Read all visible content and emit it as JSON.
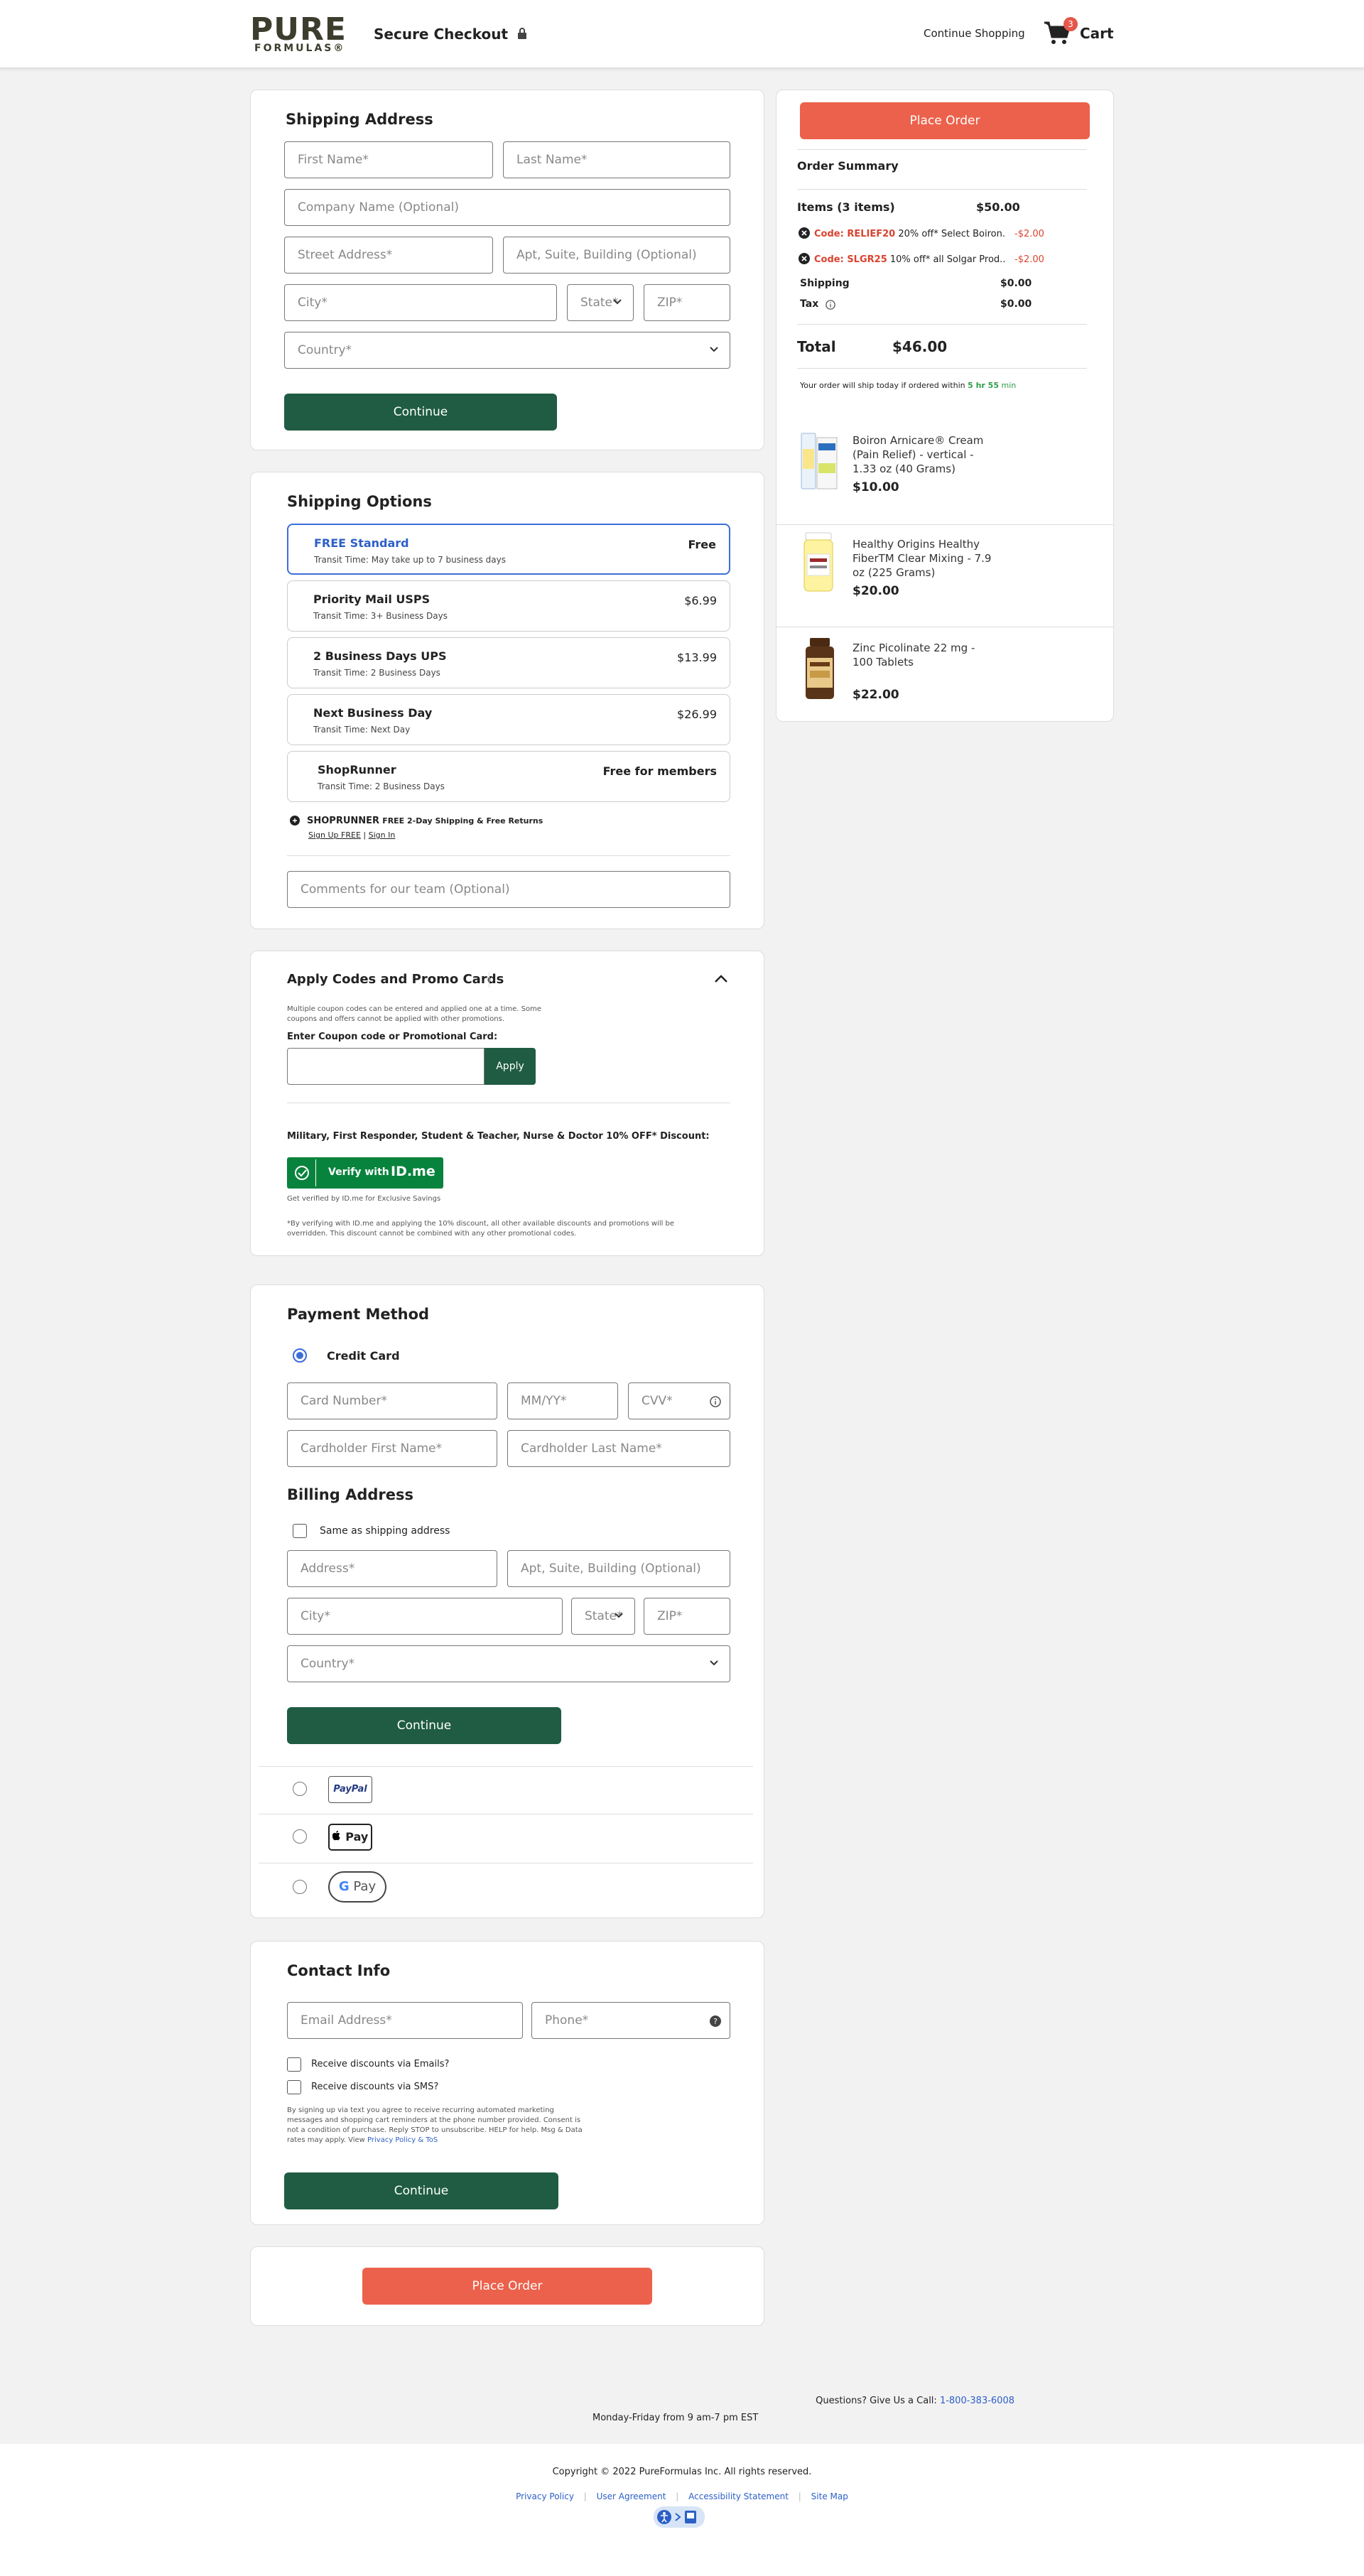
{
  "header": {
    "logo_main": "PURE",
    "logo_sub": "FORMULAS®",
    "secure_checkout": "Secure Checkout",
    "continue_shopping": "Continue Shopping",
    "cart_count": "3",
    "cart_label": "Cart"
  },
  "shipping_address": {
    "title": "Shipping Address",
    "first_name": "First Name*",
    "last_name": "Last Name*",
    "company": "Company Name (Optional)",
    "street": "Street Address*",
    "apt": "Apt, Suite, Building (Optional)",
    "city": "City*",
    "state": "State*",
    "zip": "ZIP*",
    "country": "Country*",
    "continue": "Continue"
  },
  "shipping_options": {
    "title": "Shipping Options",
    "options": [
      {
        "name": "FREE Standard",
        "transit": "Transit Time: May take up to 7 business days",
        "price": "Free"
      },
      {
        "name": "Priority Mail USPS",
        "transit": "Transit Time: 3+ Business Days",
        "price": "$6.99"
      },
      {
        "name": "2 Business Days UPS",
        "transit": "Transit Time: 2 Business Days",
        "price": "$13.99"
      },
      {
        "name": "Next Business Day",
        "transit": "Transit Time: Next Day",
        "price": "$26.99"
      },
      {
        "name": "ShopRunner",
        "transit": "Transit Time: 2 Business Days",
        "price": "Free for members"
      }
    ],
    "shoprunner_brand": "SHOPRUNNER",
    "shoprunner_text": "FREE 2-Day Shipping & Free Returns",
    "sign_up": "Sign Up FREE",
    "separator": "|",
    "sign_in": "Sign In",
    "comments": "Comments for our team (Optional)"
  },
  "promo": {
    "title": "Apply Codes and Promo Cards",
    "note": "Multiple coupon codes can be entered and applied one at a time. Some coupons and offers cannot be applied with other promotions.",
    "label": "Enter Coupon code or Promotional Card:",
    "apply": "Apply",
    "military": "Military, First Responder, Student & Teacher, Nurse & Doctor 10% OFF* Discount:",
    "verify": "Verify with",
    "idme": "ID.me",
    "verify_note": "Get verified by ID.me for Exclusive Savings",
    "disclaimer": "*By verifying with ID.me and applying the 10% discount, all other available discounts and promotions will be overridden. This discount cannot be combined with any other promotional codes."
  },
  "payment": {
    "title": "Payment Method",
    "credit_card": "Credit Card",
    "card_number": "Card Number*",
    "expiry": "MM/YY*",
    "cvv": "CVV*",
    "holder_first": "Cardholder First Name*",
    "holder_last": "Cardholder Last Name*",
    "billing_title": "Billing Address",
    "same_as_shipping": "Same as shipping address",
    "address": "Address*",
    "apt": "Apt, Suite, Building (Optional)",
    "city": "City*",
    "state": "State*",
    "zip": "ZIP*",
    "country": "Country*",
    "continue": "Continue",
    "paypal": "PayPal",
    "applepay": "Pay",
    "gpay": "Pay"
  },
  "contact": {
    "title": "Contact Info",
    "email": "Email Address*",
    "phone": "Phone*",
    "emails_opt": "Receive discounts via Emails?",
    "sms_opt": "Receive discounts via SMS?",
    "legal": "By signing up via text you agree to receive recurring automated marketing messages and shopping cart reminders at the phone number provided. Consent is not a condition of purchase. Reply STOP to unsubscribe. HELP for help. Msg & Data rates may apply. View",
    "privacy_link": "Privacy Policy & ToS",
    "continue": "Continue"
  },
  "place_order_bottom": "Place Order",
  "summary": {
    "place_order": "Place Order",
    "title": "Order Summary",
    "items_label": "Items (3 items)",
    "items_value": "$50.00",
    "codes": [
      {
        "code": "Code: RELIEF20",
        "desc": "20% off* Select Boiron...",
        "value": "-$2.00"
      },
      {
        "code": "Code: SLGR25",
        "desc": "10% off* all Solgar Prod...",
        "value": "-$2.00"
      }
    ],
    "shipping_label": "Shipping",
    "shipping_value": "$0.00",
    "tax_label": "Tax",
    "tax_value": "$0.00",
    "total_label": "Total",
    "total_value": "$46.00",
    "ship_today": "Your order will ship today if ordered within",
    "ship_time": "5 hr 55",
    "ship_min": "min",
    "products": [
      {
        "name": "Boiron Arnicare® Cream (Pain Relief) - vertical - 1.33 oz (40 Grams)",
        "price": "$10.00"
      },
      {
        "name": "Healthy Origins Healthy FiberTM Clear Mixing - 7.9 oz (225 Grams)",
        "price": "$20.00"
      },
      {
        "name": "Zinc Picolinate 22 mg - 100 Tablets",
        "price": "$22.00"
      }
    ]
  },
  "footer": {
    "questions": "Questions? Give Us a Call:",
    "phone": "1-800-383-6008",
    "hours": "Monday-Friday from 9 am-7 pm EST",
    "copyright": "Copyright © 2022 PureFormulas Inc. All rights reserved.",
    "links": [
      "Privacy Policy",
      "User Agreement",
      "Accessibility Statement",
      "Site Map"
    ]
  },
  "colors": {
    "brand_green": "#1f5c43",
    "accent_red": "#ec614b",
    "link_blue": "#2c5fc7",
    "select_blue": "#3b6ed8"
  }
}
